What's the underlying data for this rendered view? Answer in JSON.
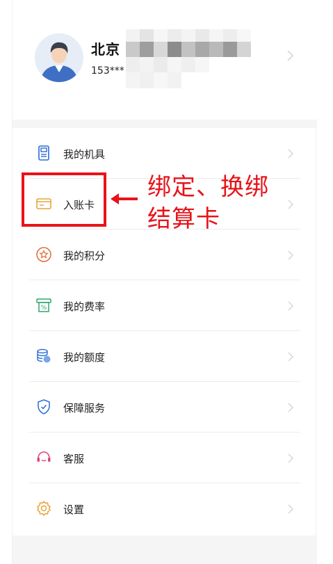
{
  "profile": {
    "name": "北京",
    "phone": "153***"
  },
  "menu": {
    "items": [
      {
        "label": "我的机具",
        "icon": "device-icon"
      },
      {
        "label": "入账卡",
        "icon": "card-icon"
      },
      {
        "label": "我的积分",
        "icon": "star-icon"
      },
      {
        "label": "我的费率",
        "icon": "rate-icon"
      },
      {
        "label": "我的额度",
        "icon": "coins-icon"
      },
      {
        "label": "保障服务",
        "icon": "shield-icon"
      },
      {
        "label": "客服",
        "icon": "headset-icon"
      },
      {
        "label": "设置",
        "icon": "gear-icon"
      }
    ]
  },
  "annotation": {
    "line1": "绑定、换绑",
    "line2": "结算卡",
    "color": "#e8131a"
  },
  "colors": {
    "accent_blue": "#2b6cd6",
    "accent_orange": "#e8a33a",
    "accent_green": "#2fa86b",
    "accent_pink": "#e0457b"
  }
}
